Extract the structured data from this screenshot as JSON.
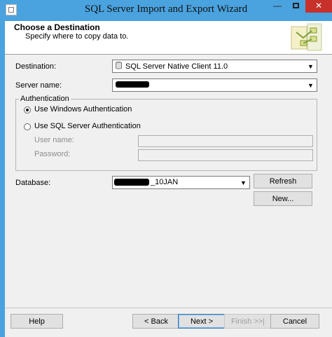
{
  "window": {
    "title": "SQL Server Import and Export Wizard",
    "minimize_glyph": "—",
    "close_glyph": "✕"
  },
  "header": {
    "title": "Choose a Destination",
    "subtitle": "Specify where to copy data to."
  },
  "destination": {
    "label": "Destination:",
    "value": "SQL Server Native Client 11.0"
  },
  "server": {
    "label": "Server name:"
  },
  "authentication": {
    "group_label": "Authentication",
    "windows_label": "Use Windows Authentication",
    "windows_selected": true,
    "sql_label": "Use SQL Server Authentication",
    "username_label": "User name:",
    "password_label": "Password:"
  },
  "database": {
    "label": "Database:",
    "value_suffix": "_10JAN",
    "refresh_label": "Refresh",
    "new_label": "New..."
  },
  "footer": {
    "help_label": "Help",
    "back_label": "< Back",
    "next_label": "Next >",
    "finish_label": "Finish >>|",
    "cancel_label": "Cancel"
  }
}
